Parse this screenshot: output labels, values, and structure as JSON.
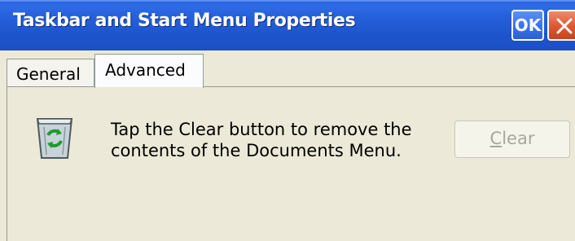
{
  "window": {
    "title": "Taskbar and Start Menu Properties",
    "ok_label": "OK",
    "close_icon": "close-icon"
  },
  "tabs": [
    {
      "label": "General",
      "selected": false
    },
    {
      "label": "Advanced",
      "selected": true
    }
  ],
  "advanced": {
    "icon": "recycle-bin-icon",
    "description": "Tap the Clear button to remove the contents of the Documents Menu.",
    "clear_button": {
      "label_mnemonic": "C",
      "label_rest": "lear",
      "enabled": false
    }
  },
  "colors": {
    "titlebar": "#1d54cc",
    "close_button": "#df5a34",
    "background": "#ece9d8",
    "disabled_text": "#a8a79b"
  }
}
